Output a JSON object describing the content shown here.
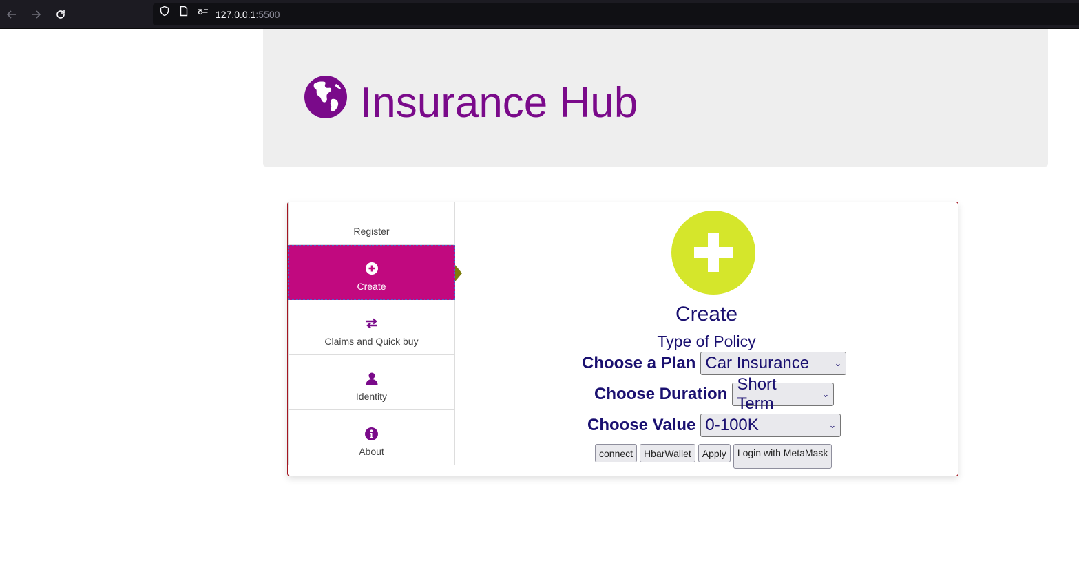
{
  "browser": {
    "url_host": "127.0.0.1",
    "url_port": ":5500"
  },
  "header": {
    "title": "Insurance Hub",
    "logo_icon": "globe-icon",
    "title_color": "#7a0a8a"
  },
  "tabs": [
    {
      "label": "Register",
      "icon": "none",
      "active": false
    },
    {
      "label": "Create",
      "icon": "plus-circle-icon",
      "active": true
    },
    {
      "label": "Claims and Quick buy",
      "icon": "exchange-icon",
      "active": false
    },
    {
      "label": "Identity",
      "icon": "user-icon",
      "active": false
    },
    {
      "label": "About",
      "icon": "info-circle-icon",
      "active": false
    }
  ],
  "main": {
    "section_title": "Create",
    "policy_label": "Type of Policy",
    "plan_label": "Choose a Plan",
    "plan_value": "Car Insurance",
    "duration_label": "Choose Duration",
    "duration_value": "Short Term",
    "value_label": "Choose Value",
    "value_value": "0-100K"
  },
  "buttons": {
    "connect": "connect",
    "hbar": "HbarWallet",
    "apply": "Apply",
    "metamask": "Login with MetaMask"
  },
  "colors": {
    "accent_magenta": "#c1097f",
    "create_circle": "#d5e62b",
    "text_navy": "#1a1070",
    "panel_border": "#a31621"
  }
}
